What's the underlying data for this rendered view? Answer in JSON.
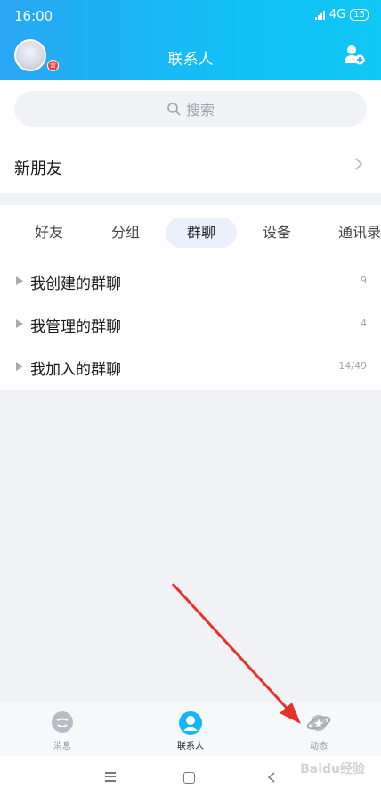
{
  "status_bar": {
    "time": "16:00",
    "network": "4G",
    "battery": "15"
  },
  "header": {
    "title": "联系人",
    "avatar_badge": "营",
    "add_contact_icon": "add-user-icon"
  },
  "search": {
    "placeholder": "搜索"
  },
  "new_friends": {
    "label": "新朋友"
  },
  "tabs": [
    {
      "label": "好友"
    },
    {
      "label": "分组"
    },
    {
      "label": "群聊",
      "active": true
    },
    {
      "label": "设备"
    },
    {
      "label": "通讯录"
    }
  ],
  "groups": [
    {
      "label": "我创建的群聊",
      "count": "9"
    },
    {
      "label": "我管理的群聊",
      "count": "4"
    },
    {
      "label": "我加入的群聊",
      "count": "14/49"
    }
  ],
  "bottom_nav": {
    "items": [
      {
        "label": "消息",
        "icon": "message-icon"
      },
      {
        "label": "联系人",
        "icon": "contacts-icon",
        "active": true
      },
      {
        "label": "动态",
        "icon": "planet-icon"
      }
    ]
  },
  "watermark": "Baidu经验",
  "colors": {
    "header_start": "#28a6f4",
    "header_end": "#0fc8f6",
    "accent": "#12b7f5",
    "arrow": "#e8312b"
  }
}
